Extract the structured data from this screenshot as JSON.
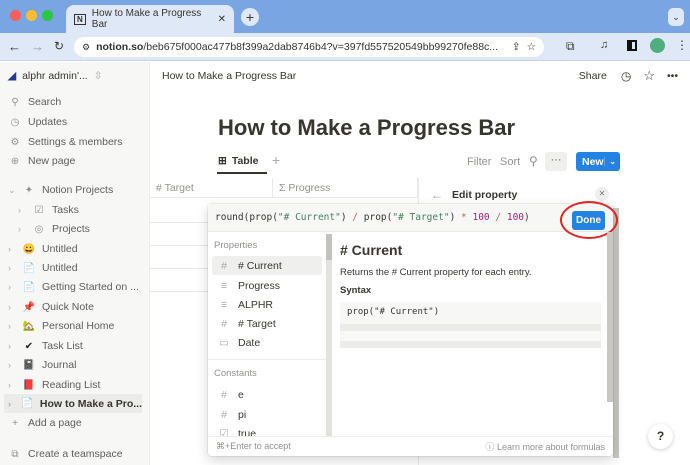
{
  "browser": {
    "tab_title": "How to Make a Progress Bar",
    "url_domain": "notion.so",
    "url_path": "/beb675f000ac477b8f399a2dab8746b4?v=397fd557520549bb99270fe88c..."
  },
  "sidebar": {
    "workspace": "alphr admin'...",
    "top": [
      {
        "icon": "search-icon",
        "label": "Search"
      },
      {
        "icon": "clock-icon",
        "label": "Updates"
      },
      {
        "icon": "gear-icon",
        "label": "Settings & members"
      },
      {
        "icon": "plus-circle-icon",
        "label": "New page"
      }
    ],
    "pages": [
      {
        "label": "Notion Projects",
        "icon": "sparkle-icon"
      },
      {
        "label": "Tasks",
        "icon": "checkbox-icon"
      },
      {
        "label": "Projects",
        "icon": "target-icon"
      },
      {
        "label": "Untitled",
        "icon": "😀"
      },
      {
        "label": "Untitled",
        "icon": "📄"
      },
      {
        "label": "Getting Started on ...",
        "icon": "📄"
      },
      {
        "label": "Quick Note",
        "icon": "📌"
      },
      {
        "label": "Personal Home",
        "icon": "🏡"
      },
      {
        "label": "Task List",
        "icon": "✔"
      },
      {
        "label": "Journal",
        "icon": "📓"
      },
      {
        "label": "Reading List",
        "icon": "📕"
      },
      {
        "label": "How to Make a Pro...",
        "icon": "📄",
        "active": true
      }
    ],
    "add_page": "Add a page",
    "create_teamspace": "Create a teamspace"
  },
  "header": {
    "breadcrumb": "How to Make a Progress Bar",
    "share": "Share"
  },
  "page": {
    "title": "How to Make a Progress Bar",
    "view_tab": "Table",
    "filter": "Filter",
    "sort": "Sort",
    "new": "New",
    "columns": [
      "# Target",
      "Σ Progress"
    ]
  },
  "edit_property": {
    "title": "Edit property"
  },
  "formula": {
    "parts": [
      "round(prop(",
      "\"# Current\"",
      ") ",
      "/",
      " prop(",
      "\"# Target\"",
      ") ",
      "*",
      " ",
      "100",
      " ",
      "/",
      " ",
      "100",
      ")"
    ],
    "done": "Done",
    "properties_label": "Properties",
    "properties": [
      {
        "icon": "#",
        "label": "# Current"
      },
      {
        "icon": "≡",
        "label": "Progress"
      },
      {
        "icon": "≡",
        "label": "ALPHR"
      },
      {
        "icon": "#",
        "label": "# Target"
      },
      {
        "icon": "▭",
        "label": "Date"
      }
    ],
    "constants_label": "Constants",
    "constants": [
      {
        "icon": "#",
        "label": "e"
      },
      {
        "icon": "#",
        "label": "pi"
      },
      {
        "icon": "☑",
        "label": "true"
      }
    ],
    "detail_title": "# Current",
    "detail_desc": "Returns the # Current property for each entry.",
    "syntax_label": "Syntax",
    "syntax": "prop(\"# Current\")",
    "accept_hint": "⌘+Enter to accept",
    "learn_more": "Learn more about formulas"
  },
  "help": "?"
}
